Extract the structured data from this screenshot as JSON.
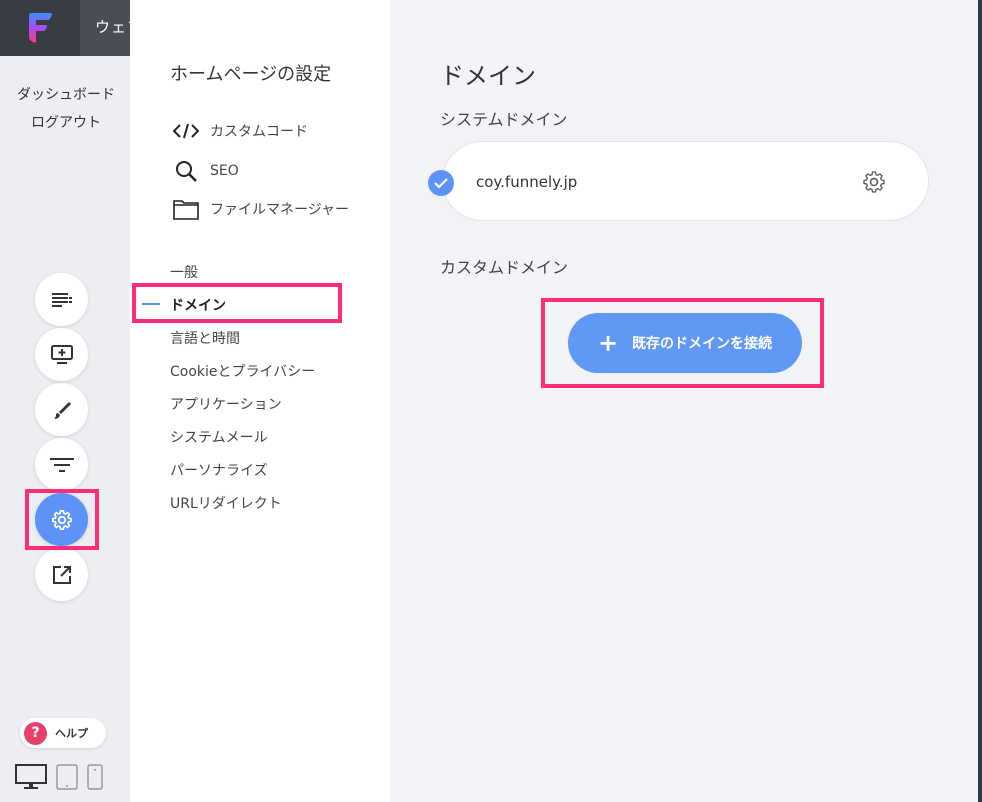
{
  "topbar": {
    "title": "ウェブ"
  },
  "sidebar_menu": {
    "dashboard": "ダッシュボード",
    "logout": "ログアウト"
  },
  "tools": [
    {
      "name": "menu-list-icon"
    },
    {
      "name": "add-screen-icon"
    },
    {
      "name": "brush-icon"
    },
    {
      "name": "filter-icon"
    },
    {
      "name": "settings-gear-icon",
      "active": true
    },
    {
      "name": "external-link-icon"
    }
  ],
  "help": {
    "label": "ヘルプ",
    "icon": "?"
  },
  "settings": {
    "title": "ホームページの設定",
    "tools": [
      {
        "label": "カスタムコード",
        "icon": "code-icon"
      },
      {
        "label": "SEO",
        "icon": "search-icon"
      },
      {
        "label": "ファイルマネージャー",
        "icon": "folder-icon"
      }
    ],
    "nav": [
      "一般",
      "ドメイン",
      "言語と時間",
      "Cookieとプライバシー",
      "アプリケーション",
      "システムメール",
      "パーソナライズ",
      "URLリダイレクト"
    ],
    "active_nav": "ドメイン"
  },
  "main": {
    "title": "ドメイン",
    "system_domain_label": "システムドメイン",
    "system_domain": "coy.funnely.jp",
    "custom_domain_label": "カスタムドメイン",
    "connect_button": "既存のドメインを接続"
  },
  "colors": {
    "accent": "#5d93f7",
    "highlight": "#ff2d79",
    "help": "#e5416b"
  }
}
